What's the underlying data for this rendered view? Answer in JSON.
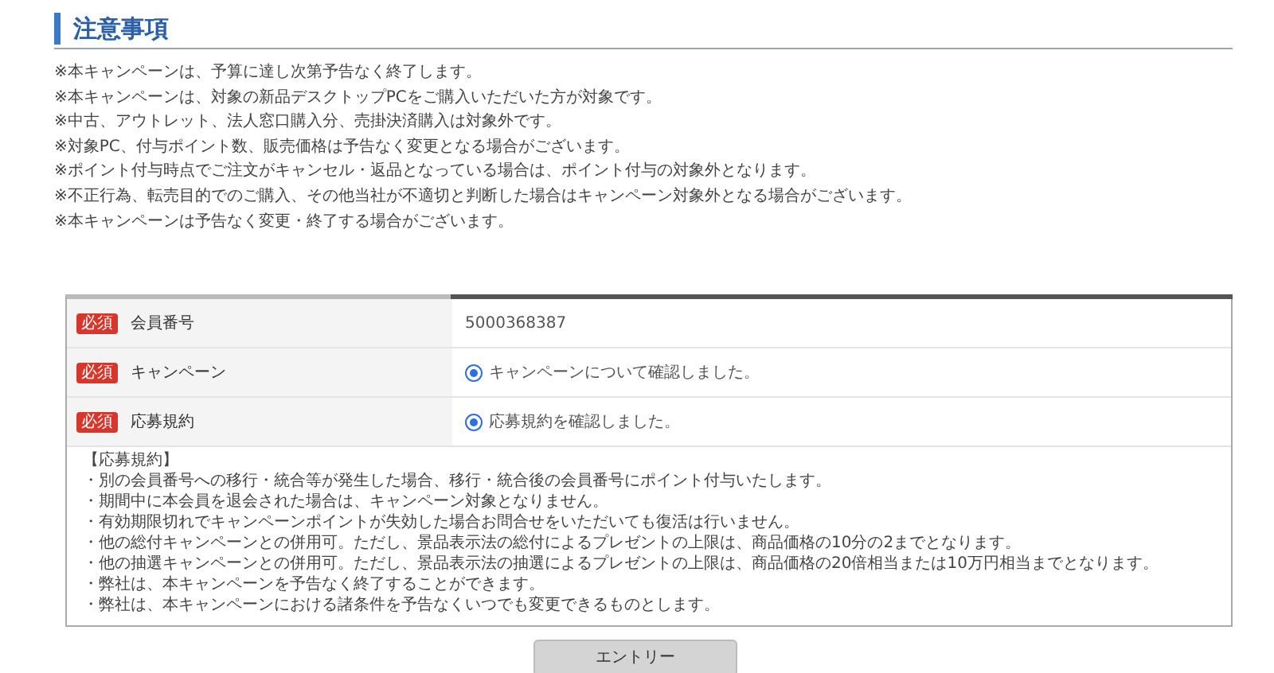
{
  "heading": "注意事項",
  "notes": [
    "※本キャンペーンは、予算に達し次第予告なく終了します。",
    "※本キャンペーンは、対象の新品デスクトップPCをご購入いただいた方が対象です。",
    "※中古、アウトレット、法人窓口購入分、売掛決済購入は対象外です。",
    "※対象PC、付与ポイント数、販売価格は予告なく変更となる場合がございます。",
    "※ポイント付与時点でご注文がキャンセル・返品となっている場合は、ポイント付与の対象外となります。",
    "※不正行為、転売目的でのご購入、その他当社が不適切と判断した場合はキャンペーン対象外となる場合がございます。",
    "※本キャンペーンは予告なく変更・終了する場合がございます。"
  ],
  "form_rows": [
    {
      "badge": "必須",
      "label": "会員番号",
      "kind": "text",
      "value": "5000368387"
    },
    {
      "badge": "必須",
      "label": "キャンペーン",
      "kind": "radio",
      "value": "キャンペーンについて確認しました。",
      "selected": true
    },
    {
      "badge": "必須",
      "label": "応募規約",
      "kind": "radio",
      "value": "応募規約を確認しました。",
      "selected": true
    }
  ],
  "terms": {
    "title": "【応募規約】",
    "items": [
      "・別の会員番号への移行・統合等が発生した場合、移行・統合後の会員番号にポイント付与いたします。",
      "・期間中に本会員を退会された場合は、キャンペーン対象となりません。",
      "・有効期限切れでキャンペーンポイントが失効した場合お問合せをいただいても復活は行いません。",
      "・他の総付キャンペーンとの併用可。ただし、景品表示法の総付によるプレゼントの上限は、商品価格の10分の2までとなります。",
      "・他の抽選キャンペーンとの併用可。ただし、景品表示法の抽選によるプレゼントの上限は、商品価格の20倍相当または10万円相当までとなります。",
      "・弊社は、本キャンペーンを予告なく終了することができます。",
      "・弊社は、本キャンペーンにおける諸条件を予告なくいつでも変更できるものとします。"
    ]
  },
  "entry_button": "エントリー"
}
